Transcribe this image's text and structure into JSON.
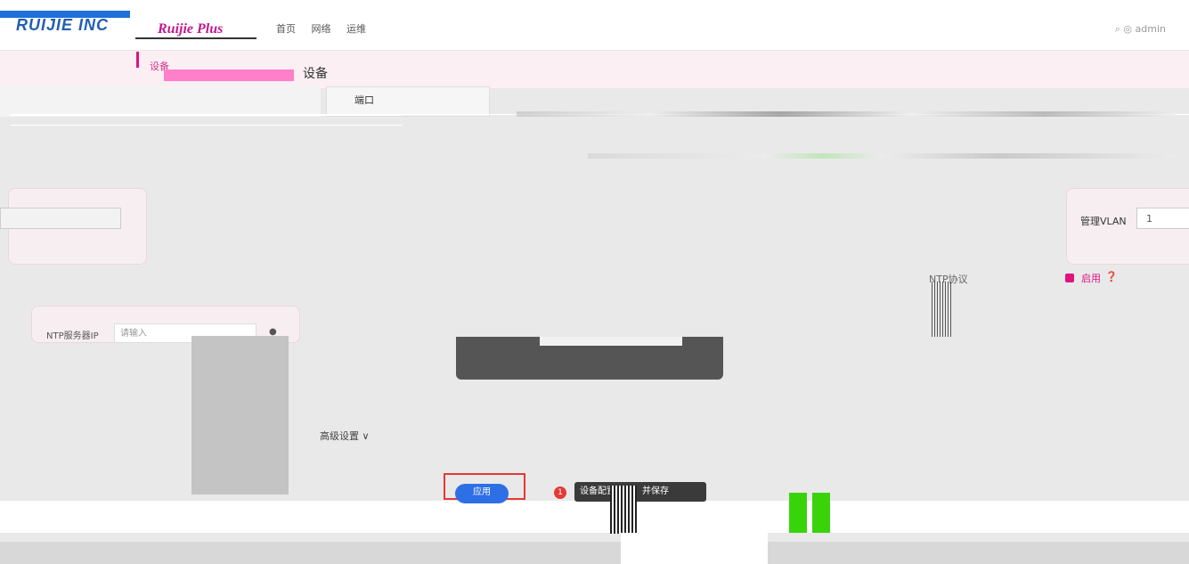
{
  "header": {
    "logo": "RUIJIE INC",
    "brand": "Ruijie Plus",
    "nav": [
      "首页",
      "网络",
      "运维"
    ],
    "user": "admin"
  },
  "sidebar": {
    "active_item": "设备"
  },
  "page": {
    "title": "设备",
    "port_label": "端口"
  },
  "management_vlan": {
    "label": "管理VLAN",
    "value": "1"
  },
  "ntp": {
    "protocol_label": "NTP协议",
    "enable_label": "启用",
    "help_icon": "question-circle-icon",
    "server_label": "NTP服务器IP",
    "server_placeholder": "请输入"
  },
  "advanced": {
    "label": "高级设置 ∨"
  },
  "actions": {
    "apply_label": "应用",
    "badge_number": "1",
    "tooltip": "设备配置下发，并保存"
  },
  "colors": {
    "accent": "#e0137f",
    "primary_button": "#2f6fe5",
    "highlight_border": "#e53935"
  }
}
